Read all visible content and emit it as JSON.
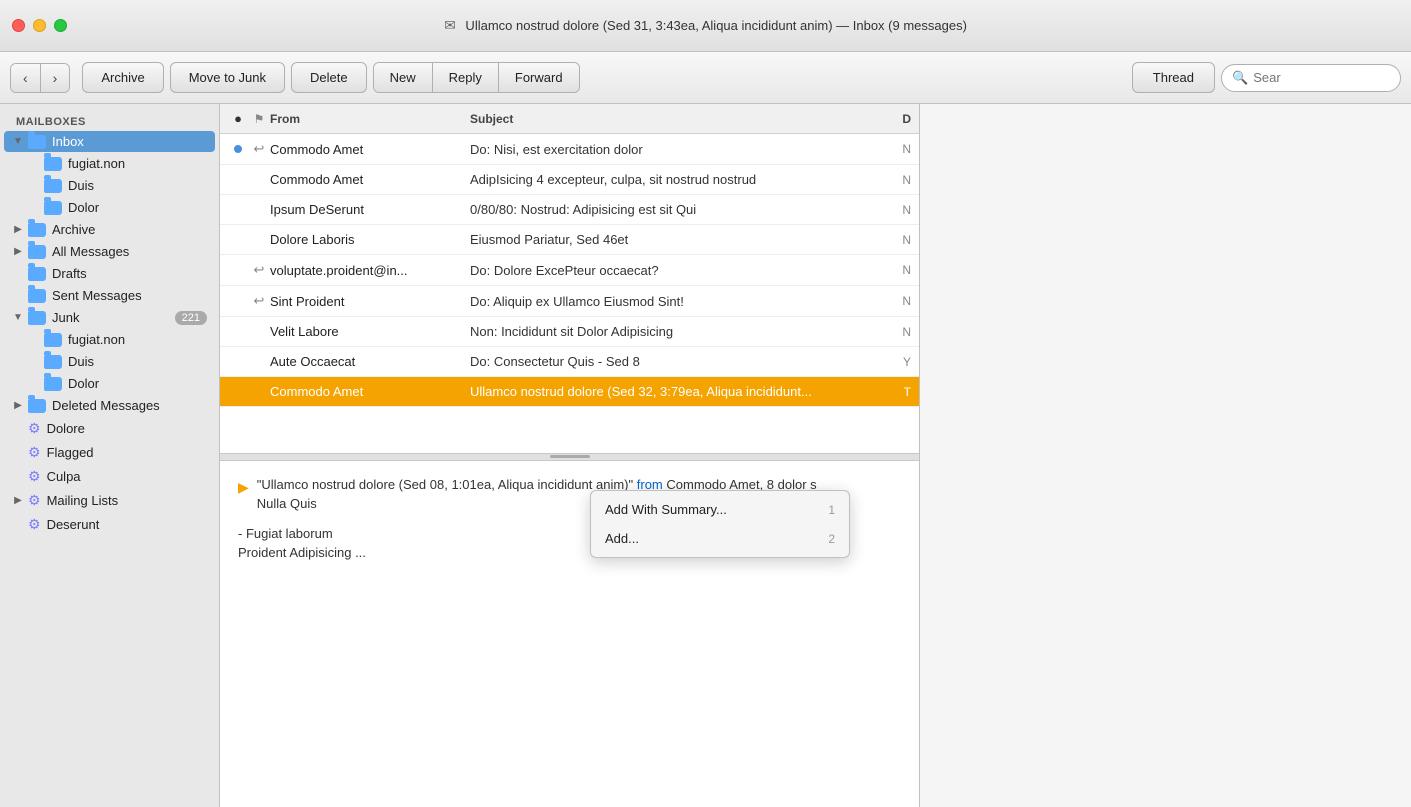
{
  "window": {
    "title": "Ullamco nostrud dolore (Sed 31, 3:43ea, Aliqua incididunt anim) — Inbox (9 messages)",
    "icon": "✉"
  },
  "toolbar": {
    "back_label": "‹",
    "forward_label": "›",
    "archive_label": "Archive",
    "move_to_junk_label": "Move to Junk",
    "delete_label": "Delete",
    "new_label": "New",
    "reply_label": "Reply",
    "forward_btn_label": "Forward",
    "thread_label": "Thread",
    "search_placeholder": "Sear"
  },
  "sidebar": {
    "section_label": "MAILBOXES",
    "items": [
      {
        "id": "inbox",
        "label": "Inbox",
        "indent": 1,
        "icon": "folder",
        "chevron": "▼",
        "selected": true
      },
      {
        "id": "fugiat-non-inbox",
        "label": "fugiat.non",
        "indent": 2,
        "icon": "folder",
        "chevron": ""
      },
      {
        "id": "duis-inbox",
        "label": "Duis",
        "indent": 2,
        "icon": "folder",
        "chevron": ""
      },
      {
        "id": "dolor-inbox",
        "label": "Dolor",
        "indent": 2,
        "icon": "folder",
        "chevron": ""
      },
      {
        "id": "archive",
        "label": "Archive",
        "indent": 1,
        "icon": "folder",
        "chevron": "▶"
      },
      {
        "id": "all-messages",
        "label": "All Messages",
        "indent": 1,
        "icon": "folder",
        "chevron": "▶"
      },
      {
        "id": "drafts",
        "label": "Drafts",
        "indent": 1,
        "icon": "folder",
        "chevron": ""
      },
      {
        "id": "sent-messages",
        "label": "Sent Messages",
        "indent": 1,
        "icon": "folder",
        "chevron": ""
      },
      {
        "id": "junk",
        "label": "Junk",
        "indent": 1,
        "icon": "folder",
        "chevron": "▼",
        "badge": "221"
      },
      {
        "id": "fugiat-non-junk",
        "label": "fugiat.non",
        "indent": 2,
        "icon": "folder",
        "chevron": ""
      },
      {
        "id": "duis-junk",
        "label": "Duis",
        "indent": 2,
        "icon": "folder",
        "chevron": ""
      },
      {
        "id": "dolor-junk",
        "label": "Dolor",
        "indent": 2,
        "icon": "folder",
        "chevron": ""
      },
      {
        "id": "deleted-messages",
        "label": "Deleted Messages",
        "indent": 1,
        "icon": "folder",
        "chevron": "▶"
      },
      {
        "id": "dolore",
        "label": "Dolore",
        "indent": 1,
        "icon": "smart",
        "chevron": ""
      },
      {
        "id": "flagged",
        "label": "Flagged",
        "indent": 1,
        "icon": "smart",
        "chevron": ""
      },
      {
        "id": "culpa",
        "label": "Culpa",
        "indent": 1,
        "icon": "smart",
        "chevron": ""
      },
      {
        "id": "mailing-lists",
        "label": "Mailing Lists",
        "indent": 1,
        "icon": "smart",
        "chevron": "▶"
      },
      {
        "id": "deserunt",
        "label": "Deserunt",
        "indent": 1,
        "icon": "smart",
        "chevron": ""
      }
    ]
  },
  "message_list": {
    "columns": {
      "dot": "●",
      "flag": "⚑",
      "from": "From",
      "subject": "Subject",
      "date": "D"
    },
    "messages": [
      {
        "id": 1,
        "dot": true,
        "reply_arrow": true,
        "from": "Commodo Amet",
        "subject": "Do: Nisi, est exercitation dolor",
        "date": "N",
        "selected": false,
        "unread": false
      },
      {
        "id": 2,
        "dot": false,
        "reply_arrow": false,
        "from": "Commodo Amet",
        "subject": "AdipIsicing 4 excepteur, culpa, sit nostrud nostrud",
        "date": "N",
        "selected": false,
        "unread": false
      },
      {
        "id": 3,
        "dot": false,
        "reply_arrow": false,
        "from": "Ipsum DeSerunt",
        "subject": "0/80/80: Nostrud: Adipisicing est sit Qui",
        "date": "N",
        "selected": false,
        "unread": false
      },
      {
        "id": 4,
        "dot": false,
        "reply_arrow": false,
        "from": "Dolore Laboris",
        "subject": "Eiusmod Pariatur, Sed 46et",
        "date": "N",
        "selected": false,
        "unread": false
      },
      {
        "id": 5,
        "dot": false,
        "reply_arrow": true,
        "from": "voluptate.proident@in...",
        "subject": "Do: Dolore ExcePteur occaecat?",
        "date": "N",
        "selected": false,
        "unread": false
      },
      {
        "id": 6,
        "dot": false,
        "reply_arrow": true,
        "from": "Sint Proident",
        "subject": "Do: Aliquip ex Ullamco Eiusmod Sint!",
        "date": "N",
        "selected": false,
        "unread": false
      },
      {
        "id": 7,
        "dot": false,
        "reply_arrow": false,
        "from": "Velit Labore",
        "subject": "Non: Incididunt sit Dolor Adipisicing",
        "date": "N",
        "selected": false,
        "unread": false
      },
      {
        "id": 8,
        "dot": false,
        "reply_arrow": false,
        "from": "Aute Occaecat",
        "subject": "Do: Consectetur Quis - Sed 8",
        "date": "Y",
        "selected": false,
        "unread": false
      },
      {
        "id": 9,
        "dot": false,
        "reply_arrow": false,
        "from": "Commodo Amet",
        "subject": "Ullamco nostrud dolore (Sed 32, 3:79ea, Aliqua incididunt...",
        "date": "T",
        "selected": true,
        "unread": false
      }
    ]
  },
  "context_menu": {
    "items": [
      {
        "id": "add-with-summary",
        "label": "Add With Summary...",
        "shortcut": "1"
      },
      {
        "id": "add",
        "label": "Add...",
        "shortcut": "2"
      }
    ]
  },
  "preview": {
    "quote": "\"Ullamco nostrud dolore (Sed 08, 1:01ea, Aliqua incididunt anim)\"",
    "from_label": "from",
    "from": "Commodo Amet, 8 dolor s",
    "extra": "Nulla Quis",
    "body_line1": "- Fugiat laborum",
    "body_line2": "Proident Adipisicing ..."
  }
}
